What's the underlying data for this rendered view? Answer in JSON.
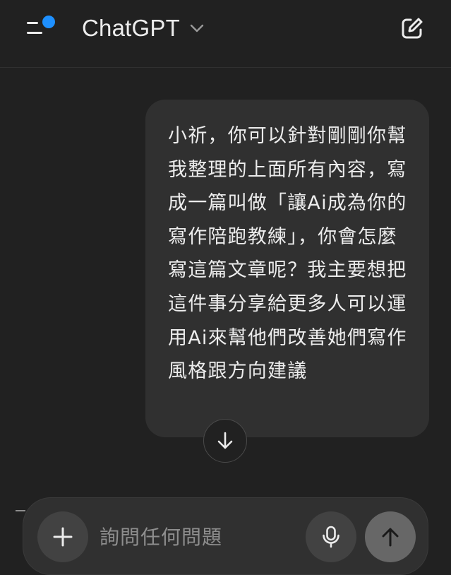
{
  "header": {
    "title": "ChatGPT",
    "menu_icon": "menu-with-notification-icon",
    "notification_dot_color": "#1e90ff",
    "title_dropdown_icon": "chevron-down-icon",
    "compose_icon": "new-chat-icon"
  },
  "chat": {
    "messages": [
      {
        "role": "user",
        "text": "小祈，你可以針對剛剛你幫我整理的上面所有內容，寫成一篇叫做「讓Ai成為你的寫作陪跑教練」，你會怎麼寫這篇文章呢？我主要想把這件事分享給更多人可以運用Ai來幫他們改善她們寫作風格跟方向建議"
      }
    ],
    "scroll_down_icon": "arrow-down-icon"
  },
  "composer": {
    "placeholder": "詢問任何問題",
    "value": "",
    "add_icon": "plus-icon",
    "voice_icon": "microphone-icon",
    "send_icon": "arrow-up-icon"
  },
  "colors": {
    "background": "#212121",
    "bubble": "#303030",
    "text": "#ececec",
    "placeholder": "#8e8e8e",
    "accent": "#1e90ff"
  }
}
